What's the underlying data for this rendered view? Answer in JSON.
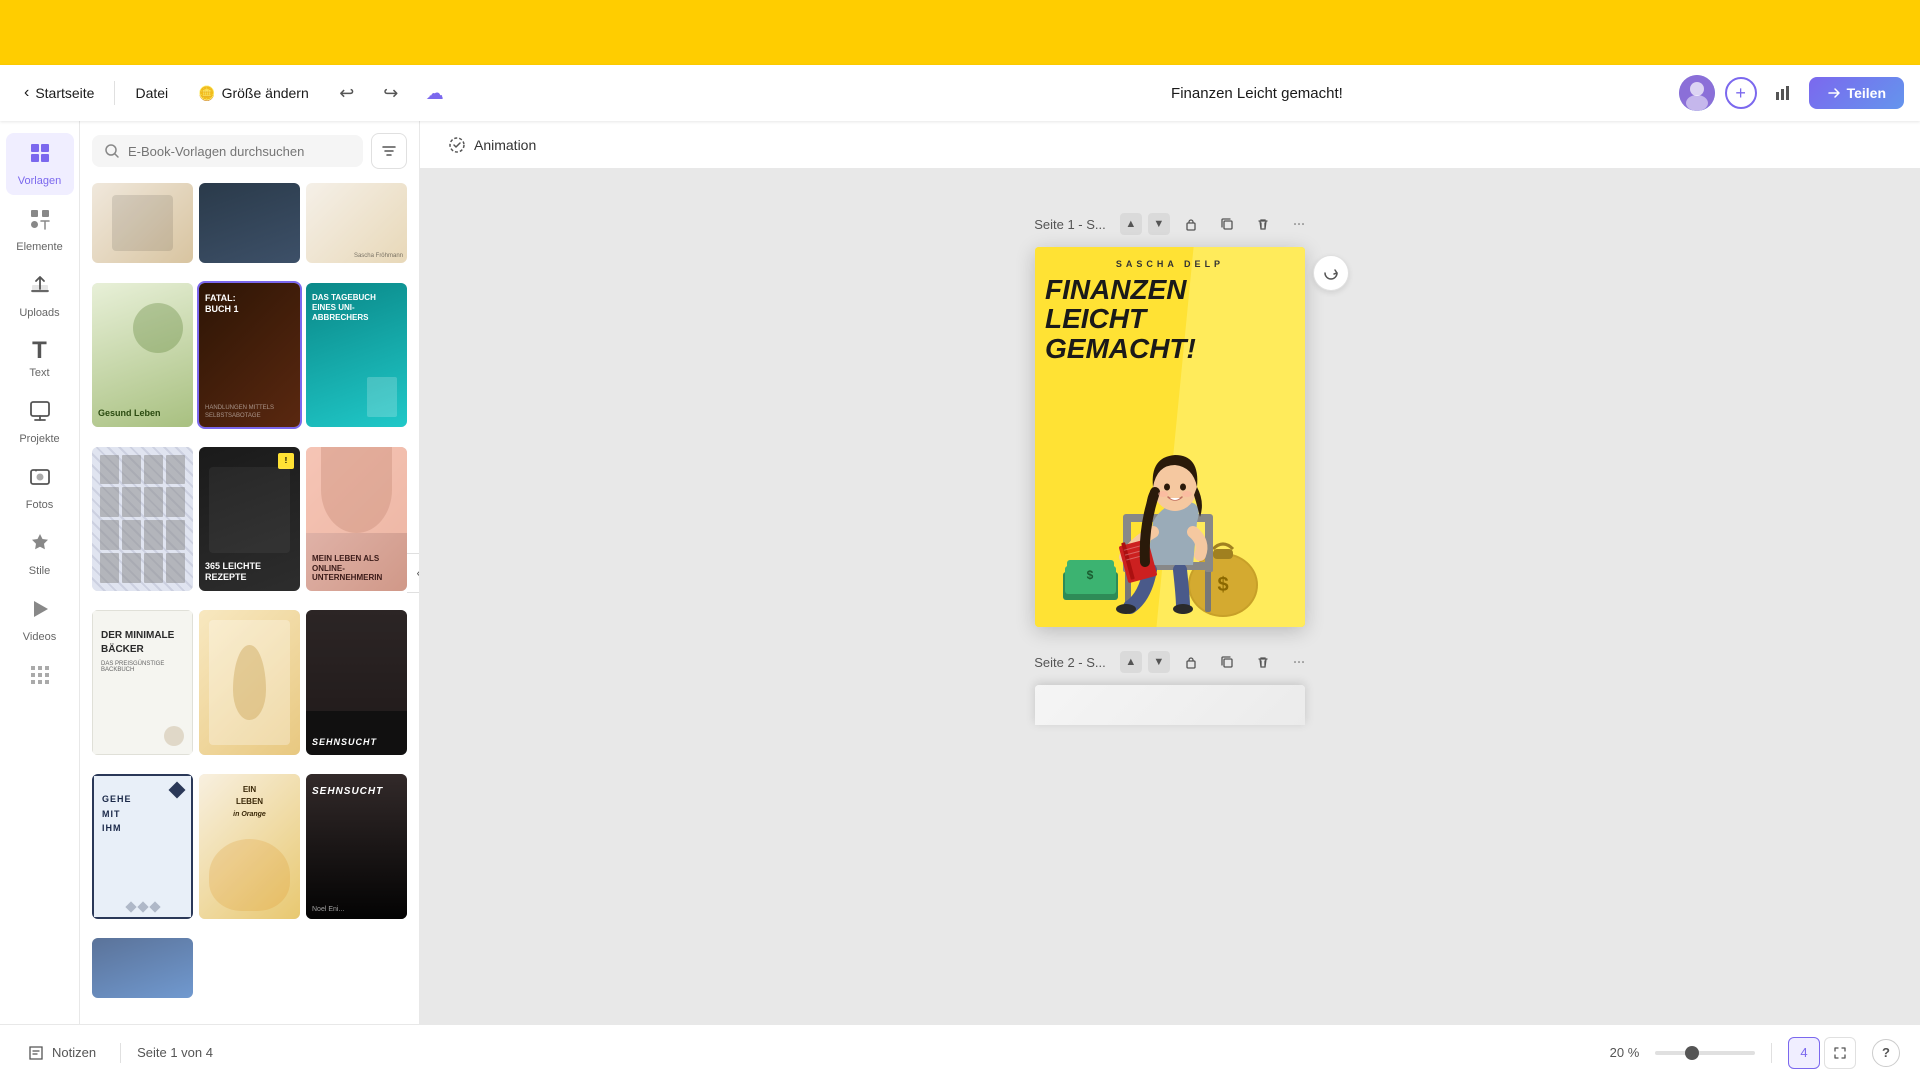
{
  "top_bar": {
    "color": "#FFCD00"
  },
  "header": {
    "back_label": "Startseite",
    "menu_datei": "Datei",
    "size_label": "Größe ändern",
    "doc_title": "Finanzen Leicht gemacht!",
    "share_label": "Teilen",
    "undo_icon": "↩",
    "redo_icon": "↪",
    "cloud_icon": "☁"
  },
  "sidebar": {
    "items": [
      {
        "id": "vorlagen",
        "label": "Vorlagen",
        "icon": "▦",
        "active": true
      },
      {
        "id": "elemente",
        "label": "Elemente",
        "icon": "✦",
        "active": false
      },
      {
        "id": "uploads",
        "label": "Uploads",
        "icon": "⬆",
        "active": false
      },
      {
        "id": "text",
        "label": "Text",
        "icon": "T",
        "active": false
      },
      {
        "id": "projekte",
        "label": "Projekte",
        "icon": "⬜",
        "active": false
      },
      {
        "id": "fotos",
        "label": "Fotos",
        "icon": "🖼",
        "active": false
      },
      {
        "id": "stile",
        "label": "Stile",
        "icon": "✧",
        "active": false
      },
      {
        "id": "videos",
        "label": "Videos",
        "icon": "▷",
        "active": false
      }
    ]
  },
  "template_panel": {
    "search_placeholder": "E-Book-Vorlagen durchsuchen",
    "templates": [
      {
        "id": 1,
        "class": "tmpl-1",
        "text": ""
      },
      {
        "id": 2,
        "class": "tmpl-2",
        "text": ""
      },
      {
        "id": 3,
        "class": "tmpl-3",
        "text": "Sascha Fröhmann"
      },
      {
        "id": 4,
        "class": "tmpl-4",
        "text": "Gesund Leben",
        "text_dark": true
      },
      {
        "id": 5,
        "class": "tmpl-5",
        "text": "FATAL: BUCH 1"
      },
      {
        "id": 6,
        "class": "tmpl-6",
        "text": "DAS TAGEBUCH EINES UNI-ABBRECHERS"
      },
      {
        "id": 7,
        "class": "tmpl-7",
        "text": ""
      },
      {
        "id": 8,
        "class": "tmpl-8",
        "text": "365 LEICHTE REZEPTE"
      },
      {
        "id": 9,
        "class": "tmpl-9",
        "text": "MEIN LEBEN ALS ONLINE-UNTERNEHMERIN"
      },
      {
        "id": 10,
        "class": "tmpl-10",
        "text": "DER MINIMALE BÄCKER",
        "text_dark": true
      },
      {
        "id": 11,
        "class": "tmpl-11",
        "text": ""
      },
      {
        "id": 12,
        "class": "tmpl-12",
        "text": ""
      },
      {
        "id": 13,
        "class": "tmpl-13",
        "text": "GEHE MIT IHM",
        "text_dark": true
      },
      {
        "id": 14,
        "class": "tmpl-14",
        "text": "EIN LEBEN in Orange",
        "text_dark": true
      },
      {
        "id": 15,
        "class": "tmpl-15",
        "text": "SEHNSUCHT"
      },
      {
        "id": 16,
        "class": "tmpl-16",
        "text": ""
      }
    ]
  },
  "canvas": {
    "animation_label": "Animation",
    "page1": {
      "label": "Seite 1 - S...",
      "author": "SASCHA DELP",
      "title_line1": "FINANZEN",
      "title_line2": "LEICHT",
      "title_line3": "GEMACHT!"
    },
    "page2": {
      "label": "Seite 2 - S..."
    }
  },
  "status_bar": {
    "notes_label": "Notizen",
    "page_info": "Seite 1 von 4",
    "zoom_level": "20 %",
    "page_count": "4",
    "help_label": "?"
  }
}
